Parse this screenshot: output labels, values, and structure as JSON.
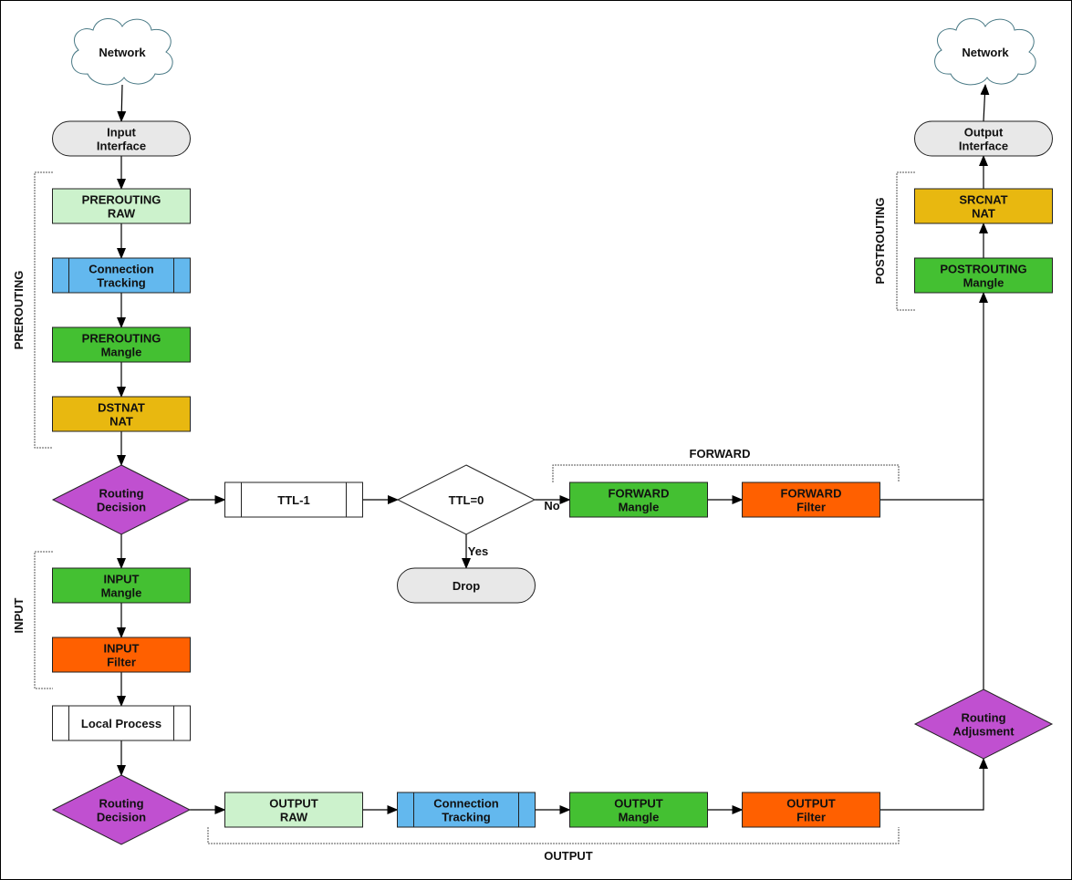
{
  "colors": {
    "raw": "#ccf2cc",
    "conntrack": "#63b8ee",
    "mangle": "#44c032",
    "nat": "#e8b810",
    "filter": "#ff6000",
    "decision": "#c050d0",
    "terminal": "#e8e8e8",
    "cloud": "#ffffff",
    "process": "#ffffff"
  },
  "nodes": {
    "network_in": {
      "lines": [
        "Network"
      ],
      "shape": "cloud-icon"
    },
    "input_interface": {
      "lines": [
        "Input",
        "Interface"
      ],
      "kind": "terminal"
    },
    "prerouting_raw": {
      "lines": [
        "PREROUTING",
        "RAW"
      ],
      "kind": "raw"
    },
    "prerouting_conntrack": {
      "lines": [
        "Connection",
        "Tracking"
      ],
      "kind": "conntrack"
    },
    "prerouting_mangle": {
      "lines": [
        "PREROUTING",
        "Mangle"
      ],
      "kind": "mangle"
    },
    "dstnat": {
      "lines": [
        "DSTNAT",
        "NAT"
      ],
      "kind": "nat"
    },
    "routing_decision_1": {
      "lines": [
        "Routing",
        "Decision"
      ],
      "kind": "decision"
    },
    "ttl_minus_1": {
      "lines": [
        "TTL-1"
      ],
      "kind": "process"
    },
    "ttl_check": {
      "lines": [
        "TTL=0"
      ],
      "kind": "process"
    },
    "drop": {
      "lines": [
        "Drop"
      ],
      "kind": "terminal"
    },
    "forward_mangle": {
      "lines": [
        "FORWARD",
        "Mangle"
      ],
      "kind": "mangle"
    },
    "forward_filter": {
      "lines": [
        "FORWARD",
        "Filter"
      ],
      "kind": "filter"
    },
    "input_mangle": {
      "lines": [
        "INPUT",
        "Mangle"
      ],
      "kind": "mangle"
    },
    "input_filter": {
      "lines": [
        "INPUT",
        "Filter"
      ],
      "kind": "filter"
    },
    "local_process": {
      "lines": [
        "Local Process"
      ],
      "kind": "process"
    },
    "routing_decision_2": {
      "lines": [
        "Routing",
        "Decision"
      ],
      "kind": "decision"
    },
    "output_raw": {
      "lines": [
        "OUTPUT",
        "RAW"
      ],
      "kind": "raw"
    },
    "output_conntrack": {
      "lines": [
        "Connection",
        "Tracking"
      ],
      "kind": "conntrack"
    },
    "output_mangle": {
      "lines": [
        "OUTPUT",
        "Mangle"
      ],
      "kind": "mangle"
    },
    "output_filter": {
      "lines": [
        "OUTPUT",
        "Filter"
      ],
      "kind": "filter"
    },
    "routing_adjustment": {
      "lines": [
        "Routing",
        "Adjusment"
      ],
      "kind": "decision"
    },
    "postrouting_mangle": {
      "lines": [
        "POSTROUTING",
        "Mangle"
      ],
      "kind": "mangle"
    },
    "srcnat": {
      "lines": [
        "SRCNAT",
        "NAT"
      ],
      "kind": "nat"
    },
    "output_interface": {
      "lines": [
        "Output",
        "Interface"
      ],
      "kind": "terminal"
    },
    "network_out": {
      "lines": [
        "Network"
      ],
      "shape": "cloud-icon"
    }
  },
  "edge_labels": {
    "no": "No",
    "yes": "Yes"
  },
  "groups": {
    "prerouting": "PREROUTING",
    "input": "INPUT",
    "forward": "FORWARD",
    "output": "OUTPUT",
    "postrouting": "POSTROUTING"
  }
}
